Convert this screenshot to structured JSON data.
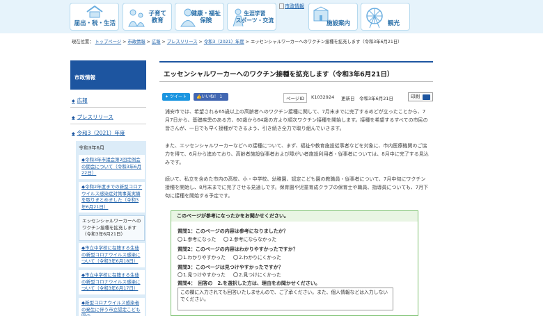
{
  "nav": {
    "tiles": [
      {
        "label": "届出・税・生活",
        "icon": "house-icon"
      },
      {
        "label": "子育て\n教育",
        "icon": "family-icon"
      },
      {
        "label": "健康・福祉\n保険",
        "icon": "health-icon"
      },
      {
        "label": "生涯学習\nスポーツ・交流",
        "icon": "sports-icon"
      },
      {
        "label": "施設案内",
        "icon": "building-icon"
      },
      {
        "label": "観光",
        "icon": "ferris-wheel-icon"
      }
    ],
    "broken_image_alt": "市政情報"
  },
  "breadcrumb": {
    "prefix": "現在位置：",
    "links": [
      "トップページ",
      "市政情報",
      "広報",
      "プレスリリース",
      "令和3（2021）年度"
    ],
    "separator": " > ",
    "current": "エッセンシャルワーカーへのワクチン接種を拡充します（令和3年6月21日）"
  },
  "sidebar": {
    "title": "市政情報",
    "links": [
      "広報",
      "プレスリリース",
      "令和3（2021）年度"
    ],
    "sub_title": "令和3年6月",
    "items": [
      "令和3年市議会第2回定例会の開会について（令和3年6月22日）",
      "令和2年度までの新型コロナウイルス感染症対策事業実績を取りまとめました（令和3年6月21日）",
      "エッセンシャルワーカーへのワクチン接種を拡充します（令和3年6月21日）",
      "市立中学校に在籍する生徒の新型コロナウイルス感染について（令和3年6月18日）",
      "市立中学校に在籍する生徒の新型コロナウイルス感染について（令和3年6月17日）",
      "新型コロナウイルス感染者の発生に伴う市立認定こども園の"
    ]
  },
  "article": {
    "title": "エッセンシャルワーカーへのワクチン接種を拡充します（令和3年6月21日）",
    "tweet_label": "ツイート",
    "like_label": "いいね！ 1",
    "page_id_label": "ページID",
    "page_id": "K1032924",
    "updated_label": "更新日",
    "updated": "令和3年6月21日",
    "print_label": "印刷",
    "paragraphs": [
      "浦安市では、希望される65歳以上の高齢者へのワクチン接種に関して、7月末までに完了するめどが立ったことから、7月7日から、基礎疾患のある方、60歳から64歳の方より順次ワクチン接種を開始します。接種を希望するすべての市民の皆さんが、一日でも早く接種ができるよう、引き続き全力で取り組んでいきます。",
      "また、エッセンシャルワーカーなどへの接種について、まず、福祉や教育施設従事者などを対象に、市内医療機関のご協力を得て、6月から進めており、高齢者施設従事者および障がい者施設利用者・従事者については、8月中に完了する見込みです。",
      "続いて、私立を含めた市内の高校、小・中学校、幼稚園、認定こども園の教職員・従事者について、7月中旬にワクチン接種を開始し、8月末までに完了させる見通しです。保育園や児童育成クラブの保育士や職員、指導員についても、7月下旬に接種を開始する予定です。"
    ]
  },
  "survey": {
    "title": "このページが参考になったかをお聞かせください。",
    "questions": [
      {
        "q": "質問1：このページの内容は参考になりましたか？",
        "options": [
          "1.参考になった",
          "2.参考にならなかった"
        ]
      },
      {
        "q": "質問2：このページの内容はわかりやすかったですか？",
        "options": [
          "1.わかりやすかった",
          "2.わかりにくかった"
        ]
      },
      {
        "q": "質問3：このページは見つけやすかったですか？",
        "options": [
          "1.見つけやすかった",
          "2.見つけにくかった"
        ]
      }
    ],
    "q4": "質問4：　回答の　2.を選択した方は、理由をお聞かせください。",
    "textarea_value": "この欄に入力されても回答いたしませんので、ご了承ください。また、個人情報などは入力しないでください。"
  }
}
